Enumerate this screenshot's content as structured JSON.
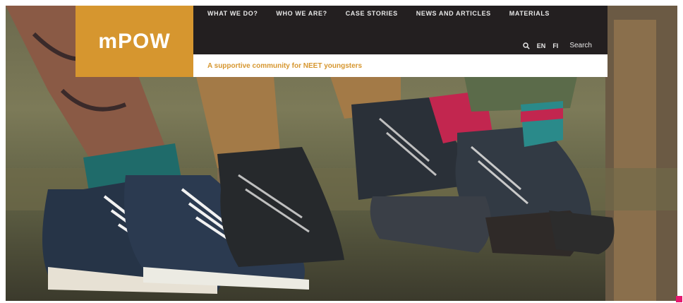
{
  "brand": {
    "logo_text": "mPOW",
    "accent_color": "#d6962f",
    "nav_bg": "#231f20"
  },
  "nav": {
    "items": [
      {
        "label": "WHAT WE DO?"
      },
      {
        "label": "WHO WE ARE?"
      },
      {
        "label": "CASE STORIES"
      },
      {
        "label": "NEWS AND ARTICLES"
      },
      {
        "label": "MATERIALS"
      }
    ],
    "lang_en": "EN",
    "lang_fi": "FI",
    "search_label": "Search"
  },
  "tagline": "A supportive community for NEET youngsters",
  "hero": {
    "image": "photo-of-legs-and-boots",
    "marker_color": "#e6186f"
  }
}
